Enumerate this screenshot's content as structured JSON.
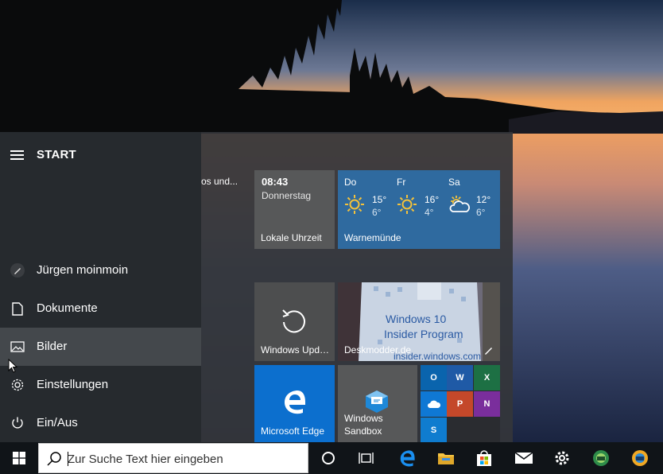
{
  "start_menu": {
    "title": "START",
    "truncated_text": "os und...",
    "rail_items": [
      {
        "label": "Jürgen moinmoin",
        "icon": "user-avatar-icon"
      },
      {
        "label": "Dokumente",
        "icon": "document-icon"
      },
      {
        "label": "Bilder",
        "icon": "pictures-icon"
      },
      {
        "label": "Einstellungen",
        "icon": "gear-icon"
      },
      {
        "label": "Ein/Aus",
        "icon": "power-icon"
      }
    ]
  },
  "tiles": {
    "clock": {
      "time": "08:43",
      "day": "Donnerstag",
      "label": "Lokale Uhrzeit"
    },
    "weather": {
      "location": "Warnemünde",
      "days": [
        {
          "name": "Do",
          "high": "15°",
          "low": "6°",
          "icon": "sun-icon"
        },
        {
          "name": "Fr",
          "high": "16°",
          "low": "4°",
          "icon": "sun-icon"
        },
        {
          "name": "Sa",
          "high": "12°",
          "low": "6°",
          "icon": "partly-cloudy-icon"
        }
      ]
    },
    "windows_update": {
      "label": "Windows Upd…"
    },
    "deskmodder": {
      "label": "Deskmodder.de",
      "image_text_1": "Windows 10",
      "image_text_2": "Insider Program",
      "image_text_3": "insider.windows.com"
    },
    "edge": {
      "label": "Microsoft Edge"
    },
    "sandbox": {
      "label_1": "Windows",
      "label_2": "Sandbox"
    },
    "office": {
      "apps": [
        {
          "letter": "O",
          "name": "outlook-icon",
          "color": "#0a64ad"
        },
        {
          "letter": "W",
          "name": "word-icon",
          "color": "#1f5aa6"
        },
        {
          "letter": "X",
          "name": "excel-icon",
          "color": "#1d7044"
        },
        {
          "letter": "",
          "name": "onedrive-icon",
          "color": "#0f78d4"
        },
        {
          "letter": "P",
          "name": "powerpoint-icon",
          "color": "#c4482a"
        },
        {
          "letter": "N",
          "name": "onenote-icon",
          "color": "#7a2e9c"
        },
        {
          "letter": "S",
          "name": "skype-icon",
          "color": "#0f7ccf"
        }
      ]
    }
  },
  "taskbar": {
    "search_placeholder": "Zur Suche Text hier eingeben",
    "buttons": [
      "windows-start-icon",
      "cortana-icon",
      "task-view-icon",
      "edge-icon",
      "file-explorer-icon",
      "store-icon",
      "mail-icon",
      "settings-icon",
      "edge-dev-icon",
      "edge-canary-icon"
    ]
  },
  "colors": {
    "accent": "#0c6fce",
    "rail_bg": "#262a2e",
    "taskbar_bg": "#101418"
  }
}
